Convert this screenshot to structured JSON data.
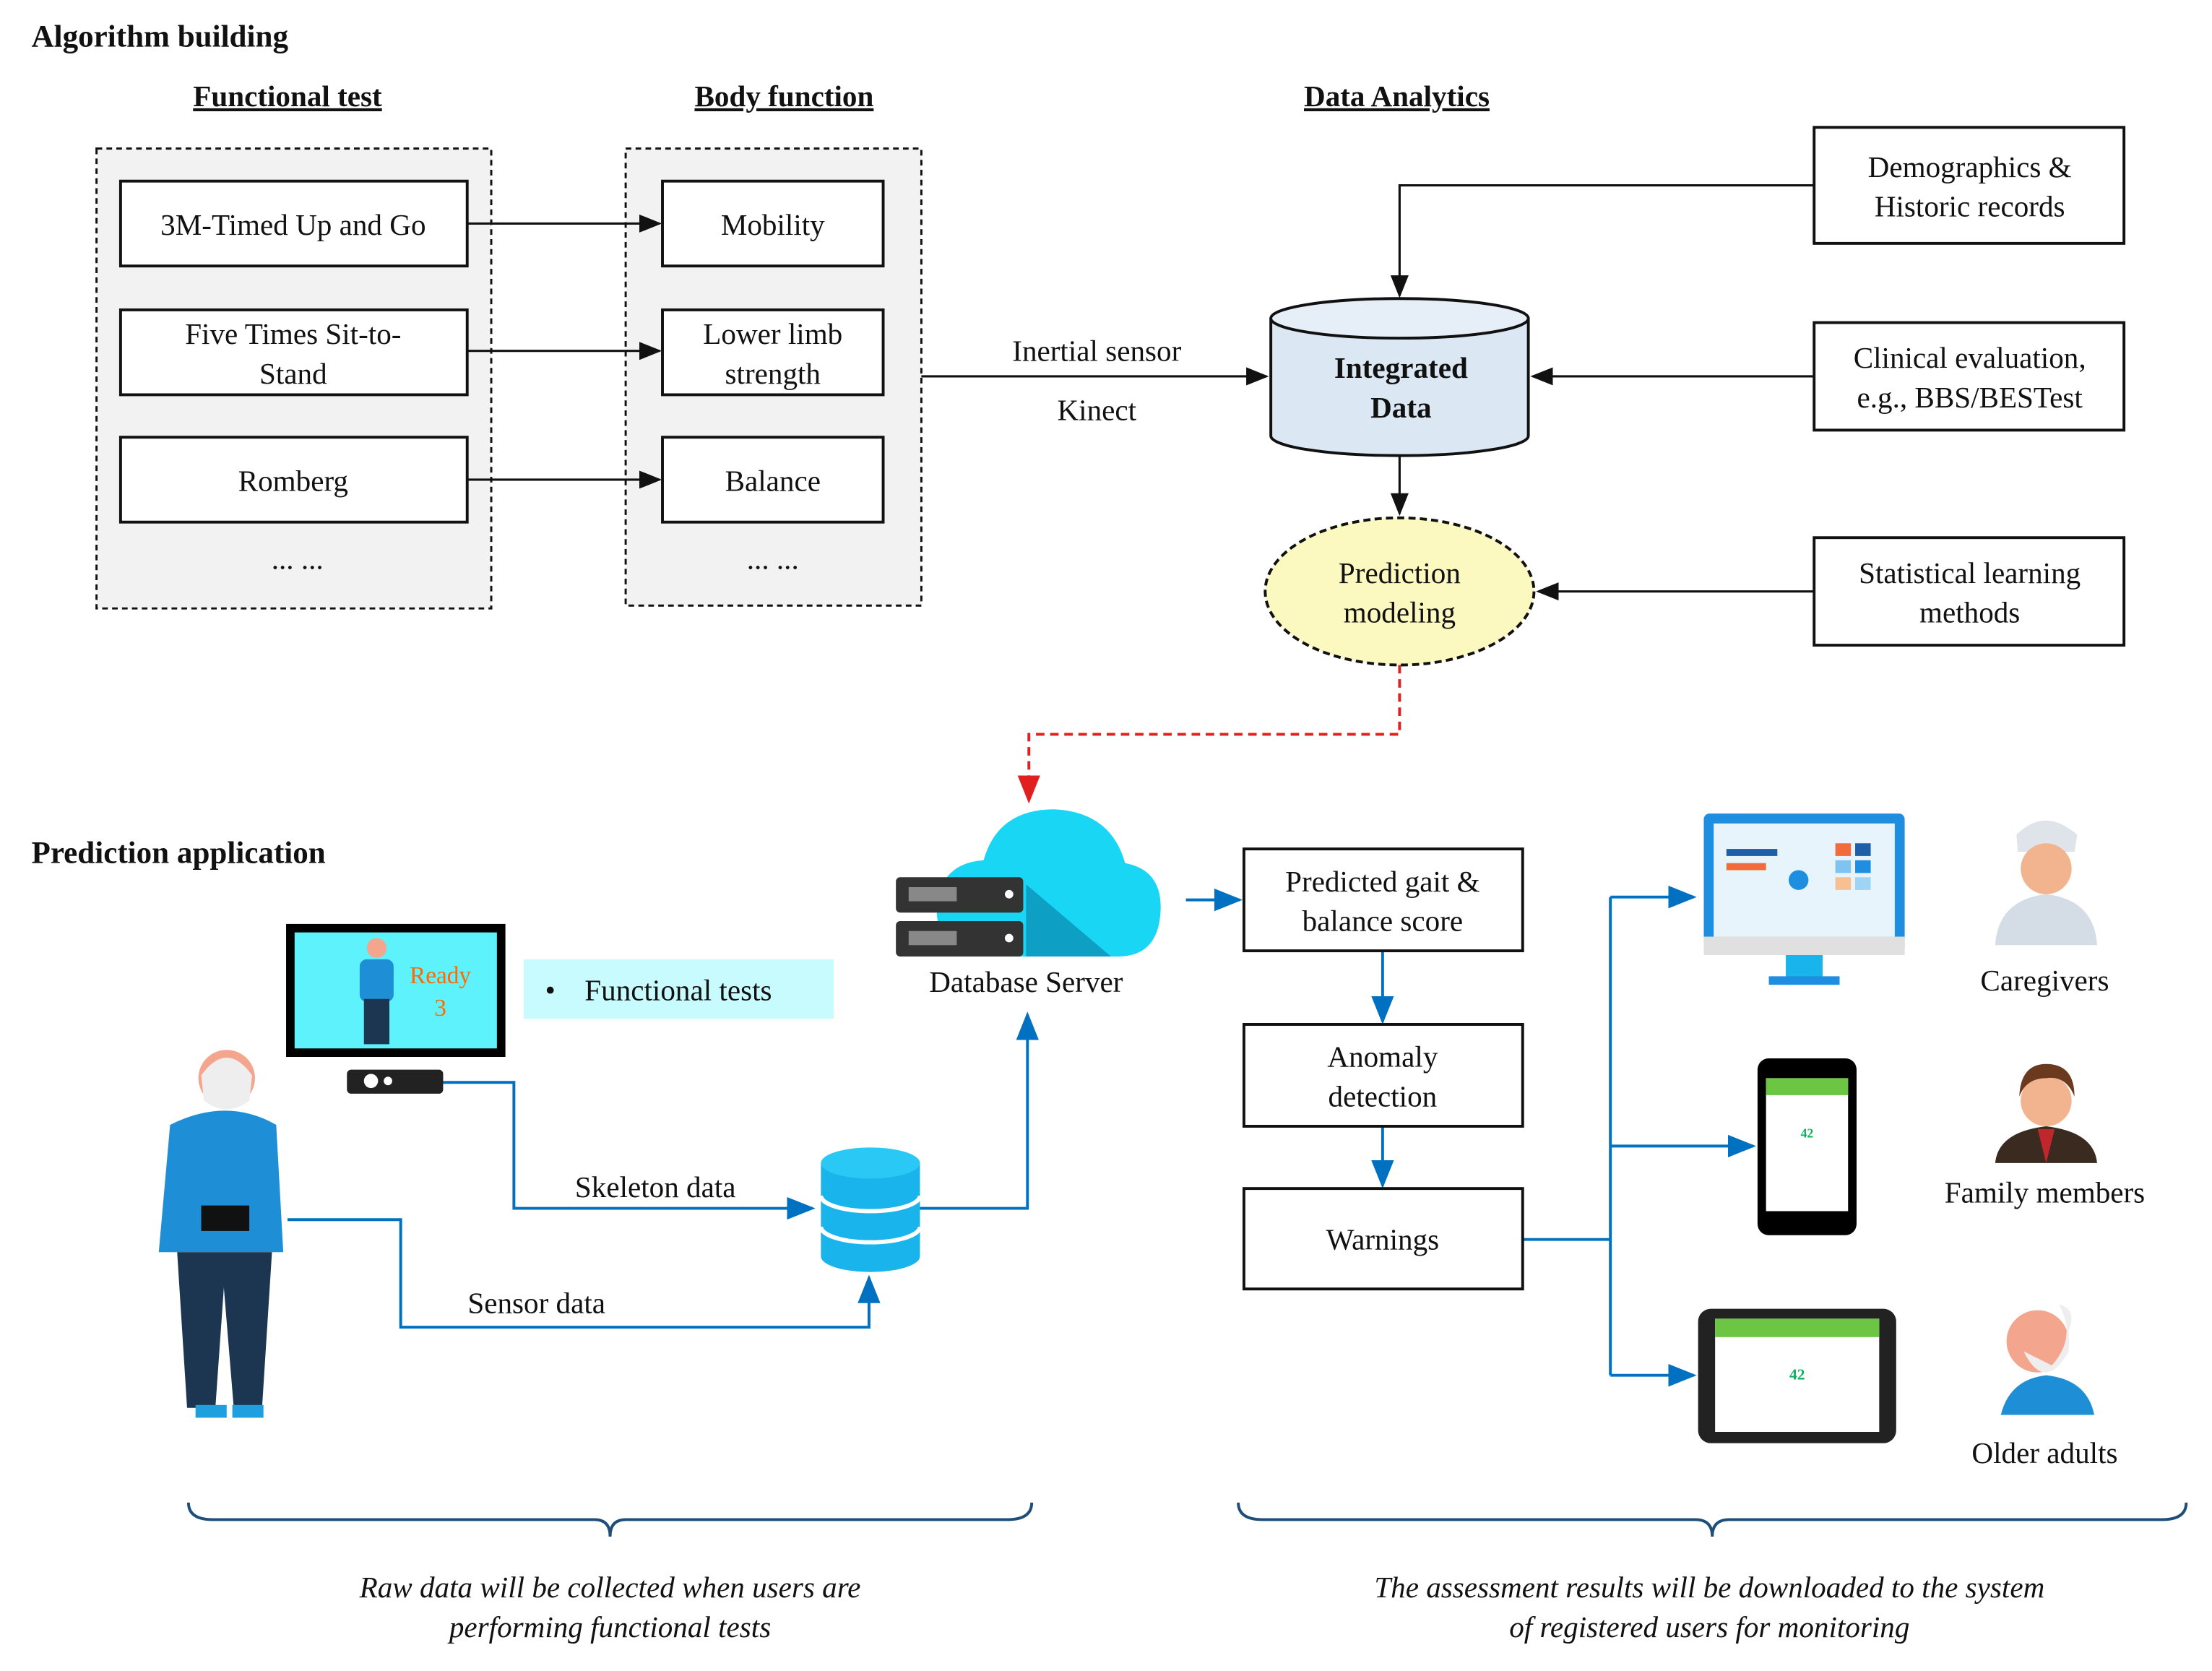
{
  "sections": {
    "algorithm": "Algorithm building",
    "application": "Prediction application"
  },
  "headers": {
    "functional_test": "Functional  test",
    "body_function": "Body function",
    "data_analytics": "Data Analytics"
  },
  "functional_tests": [
    [
      "3M-Timed Up and Go"
    ],
    [
      "Five Times Sit-to-",
      "Stand"
    ],
    [
      "Romberg"
    ]
  ],
  "body_functions": [
    [
      "Mobility"
    ],
    [
      "Lower limb",
      "strength"
    ],
    [
      "Balance"
    ]
  ],
  "ellipsis": "... ...",
  "sensor_labels": {
    "inertial": "Inertial sensor",
    "kinect": "Kinect"
  },
  "integrated": [
    "Integrated",
    "Data"
  ],
  "inputs": {
    "demographics": [
      "Demographics &",
      "Historic records"
    ],
    "clinical": [
      "Clinical evaluation,",
      "e.g., BBS/BESTest"
    ],
    "statistical": [
      "Statistical learning",
      "methods"
    ]
  },
  "prediction": [
    "Prediction",
    "modeling"
  ],
  "tv": {
    "ready": "Ready",
    "count": "3"
  },
  "functional_tests_tag": "Functional tests",
  "database_server": "Database Server",
  "flow_labels": {
    "skeleton": "Skeleton data",
    "sensor": "Sensor data"
  },
  "pipeline": [
    [
      "Predicted gait &",
      "balance score"
    ],
    [
      "Anomaly",
      "detection"
    ],
    [
      "Warnings"
    ]
  ],
  "device_score": "42",
  "users": {
    "caregivers": "Caregivers",
    "family": "Family members",
    "older": "Older adults"
  },
  "captions": {
    "left": [
      "Raw data will be collected when users are",
      "performing functional tests"
    ],
    "right": [
      "The assessment results will be downloaded to the system",
      "of registered users for monitoring"
    ]
  },
  "colors": {
    "flow_blue": "#0070c0",
    "cloud": "#1ad6f5",
    "dashed_red": "#e02020",
    "cylinder": "#dbe7f3",
    "ellipse": "#fbf8c0",
    "ready_orange": "#ff6a00"
  }
}
